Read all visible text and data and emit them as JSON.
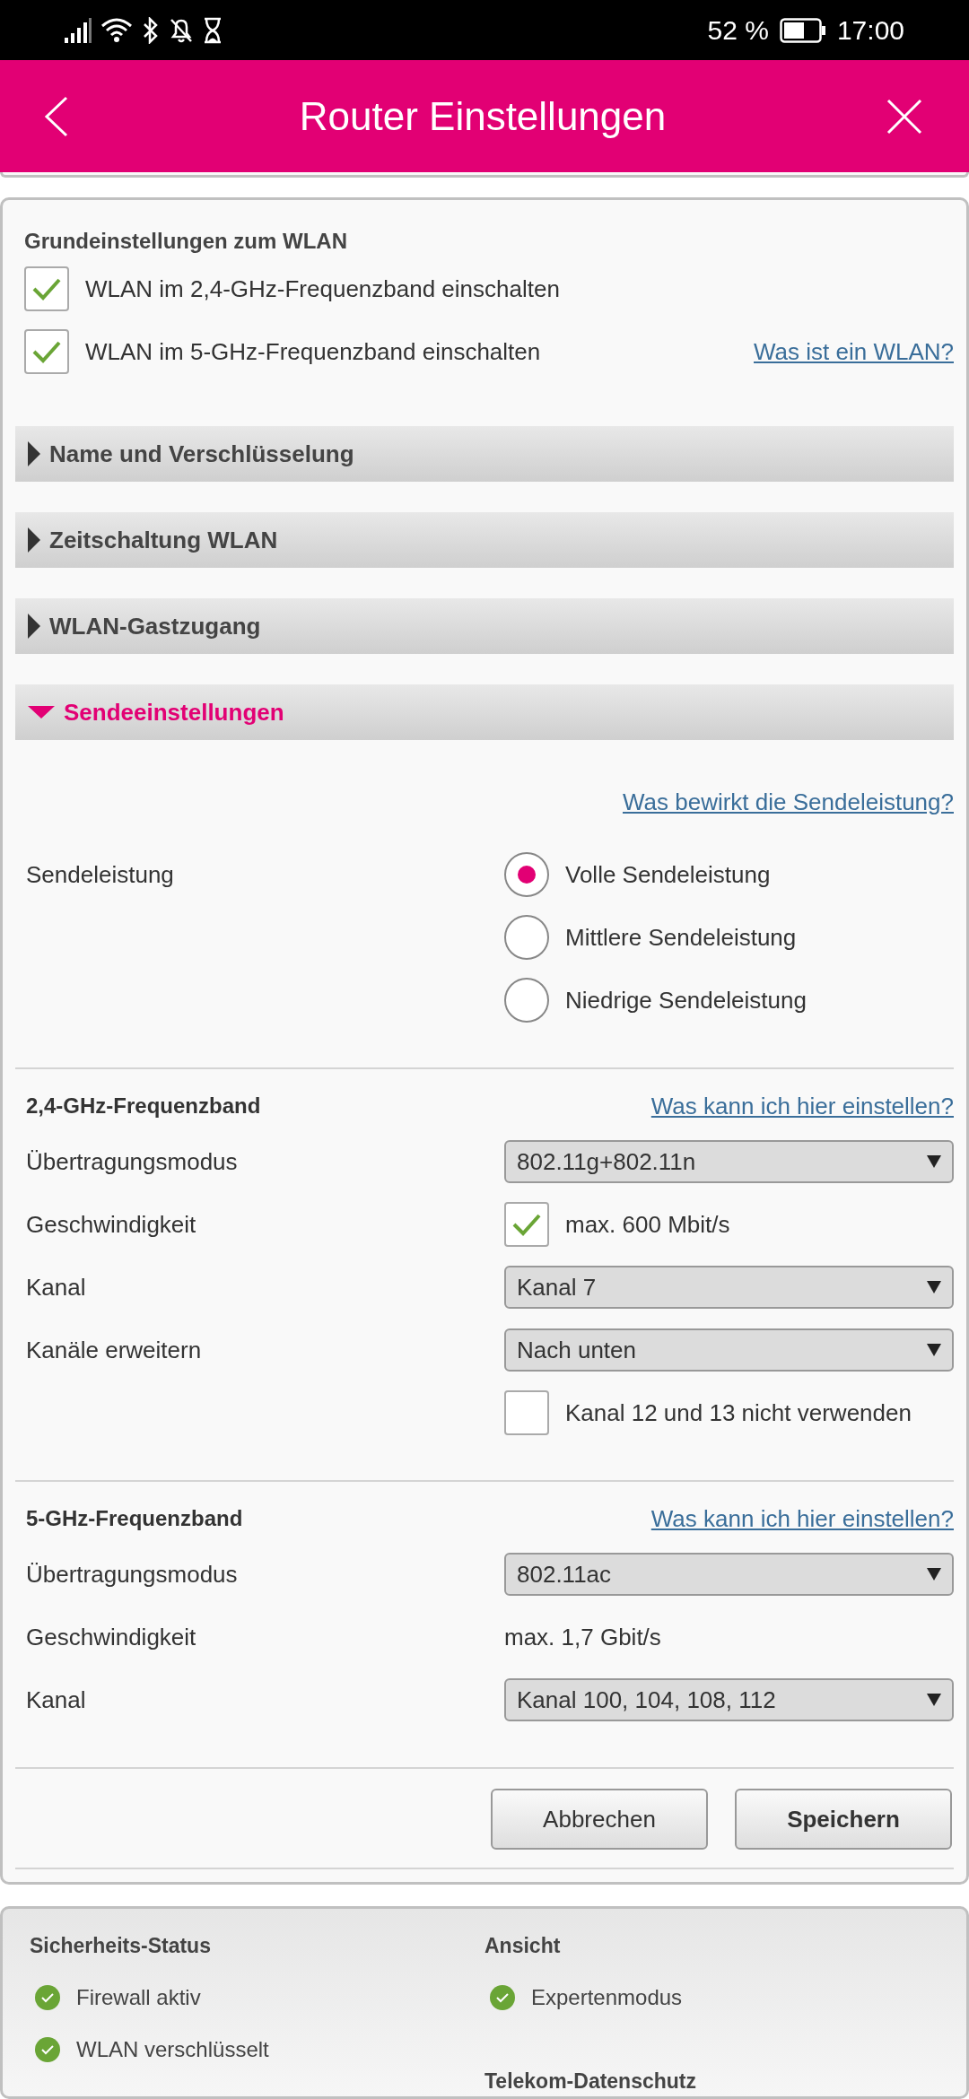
{
  "status_bar": {
    "battery": "52 %",
    "time": "17:00"
  },
  "header": {
    "title": "Router Einstellungen"
  },
  "basic": {
    "title": "Grundeinstellungen zum WLAN",
    "link": "Was ist ein WLAN?",
    "checkboxes": [
      {
        "label": "WLAN im 2,4-GHz-Frequenzband einschalten",
        "checked": true
      },
      {
        "label": "WLAN im 5-GHz-Frequenzband einschalten",
        "checked": true
      }
    ]
  },
  "sections": [
    {
      "title": "Name und Verschlüsselung",
      "expanded": false
    },
    {
      "title": "Zeitschaltung WLAN",
      "expanded": false
    },
    {
      "title": "WLAN-Gastzugang",
      "expanded": false
    },
    {
      "title": "Sendeeinstellungen",
      "expanded": true
    }
  ],
  "transmit": {
    "link": "Was bewirkt die Sendeleistung?",
    "label": "Sendeleistung",
    "options": [
      {
        "label": "Volle Sendeleistung",
        "selected": true
      },
      {
        "label": "Mittlere Sendeleistung",
        "selected": false
      },
      {
        "label": "Niedrige Sendeleistung",
        "selected": false
      }
    ]
  },
  "bands": [
    {
      "title": "2,4-GHz-Frequenzband",
      "link": "Was kann ich hier einstellen?",
      "rows": [
        {
          "kind": "select",
          "label": "Übertragungsmodus",
          "value": "802.11g+802.11n"
        },
        {
          "kind": "checkbox",
          "label": "Geschwindigkeit",
          "value": "max. 600 Mbit/s",
          "checked": true
        },
        {
          "kind": "select",
          "label": "Kanal",
          "value": "Kanal 7"
        },
        {
          "kind": "select",
          "label": "Kanäle erweitern",
          "value": "Nach unten"
        },
        {
          "kind": "checkbox",
          "value": "Kanal 12 und 13 nicht verwenden",
          "checked": false
        }
      ]
    },
    {
      "title": "5-GHz-Frequenzband",
      "link": "Was kann ich hier einstellen?",
      "rows": [
        {
          "kind": "select",
          "label": "Übertragungsmodus",
          "value": "802.11ac"
        },
        {
          "kind": "text",
          "label": "Geschwindigkeit",
          "value": "max. 1,7 Gbit/s"
        },
        {
          "kind": "select",
          "label": "Kanal",
          "value": "Kanal 100, 104, 108, 112"
        }
      ]
    }
  ],
  "buttons": [
    {
      "label": "Abbrechen",
      "primary": false
    },
    {
      "label": "Speichern",
      "primary": true
    }
  ],
  "footer": {
    "columns": [
      {
        "title": "Sicherheits-Status",
        "items": [
          "Firewall aktiv",
          "WLAN verschlüsselt"
        ]
      },
      {
        "title": "Ansicht",
        "items": [
          "Expertenmodus"
        ],
        "subtitle": "Telekom-Datenschutz"
      }
    ]
  }
}
